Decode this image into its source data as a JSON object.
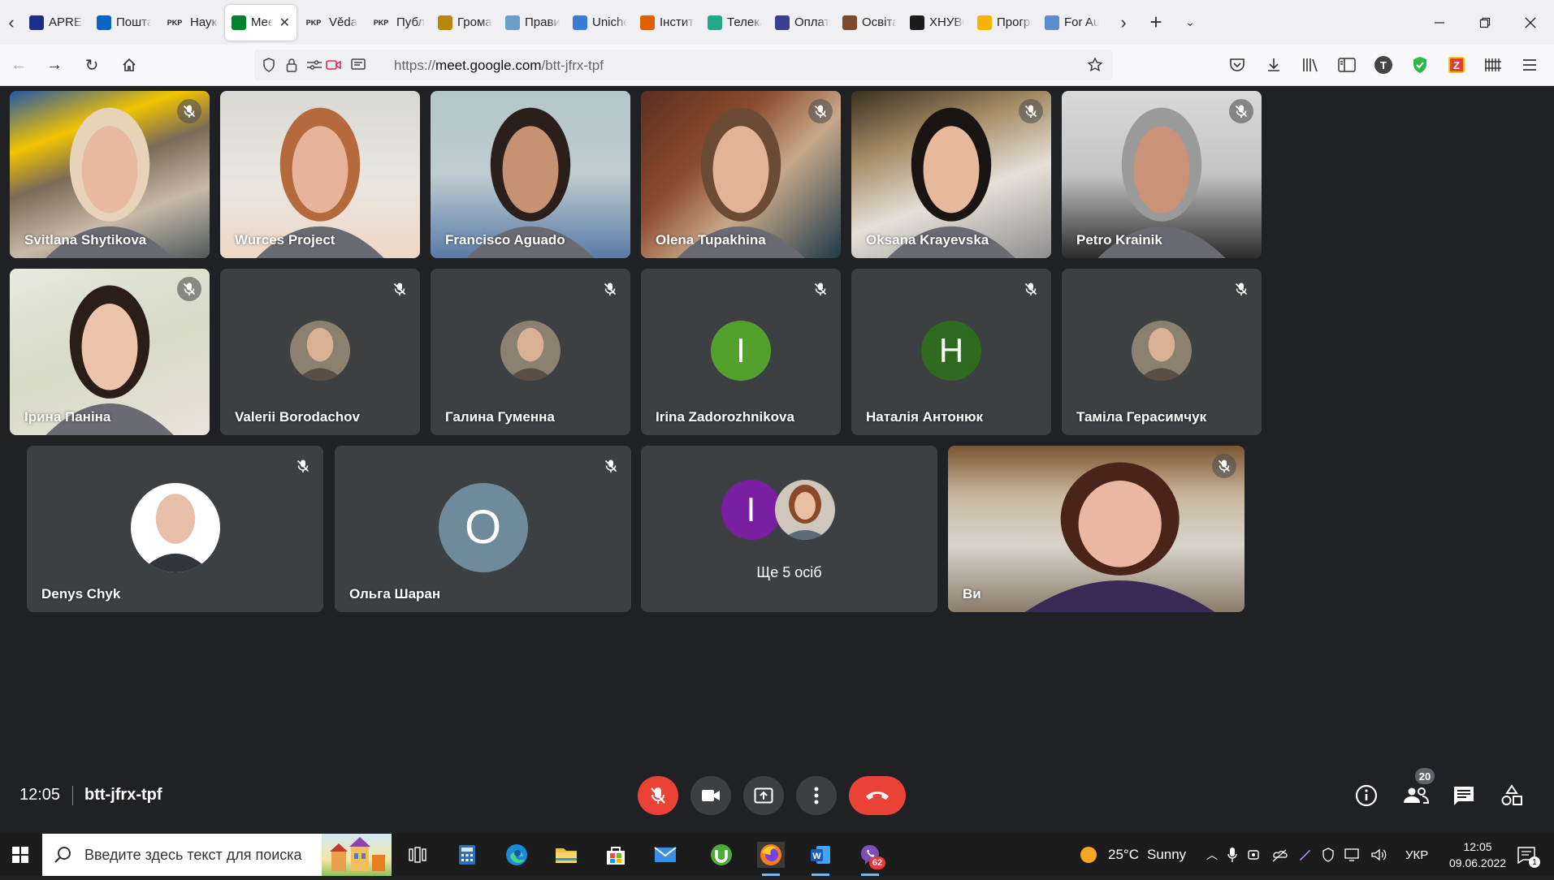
{
  "browser": {
    "tabs": [
      {
        "label": "APREI",
        "favicon_color": "#1b2f8a"
      },
      {
        "label": "Пошта",
        "favicon_color": "#0a64c8"
      },
      {
        "label": "Наукова",
        "favicon_color": "#333333",
        "favicon_text": "PKP"
      },
      {
        "label": "Meet - відео",
        "favicon_color": "#00832d",
        "active": true
      },
      {
        "label": "Věda a",
        "favicon_color": "#333333",
        "favicon_text": "PKP"
      },
      {
        "label": "Публікації",
        "favicon_color": "#333333",
        "favicon_text": "PKP"
      },
      {
        "label": "Громадськ",
        "favicon_color": "#b8860b"
      },
      {
        "label": "Правила",
        "favicon_color": "#6aa0c8"
      },
      {
        "label": "Unicheck",
        "favicon_color": "#3a7bd5"
      },
      {
        "label": "Інститут",
        "favicon_color": "#e06000"
      },
      {
        "label": "Телеканал",
        "favicon_color": "#22aa88"
      },
      {
        "label": "Оплата",
        "favicon_color": "#3b3f8f"
      },
      {
        "label": "Освіта",
        "favicon_color": "#7a4a2a"
      },
      {
        "label": "ХНУВС || Н",
        "favicon_color": "#1c1c1c"
      },
      {
        "label": "Програма",
        "favicon_color": "#f4b400"
      },
      {
        "label": "For Au",
        "favicon_color": "#5b8cd0"
      }
    ],
    "url_scheme": "https://",
    "url_domain": "meet.google.com",
    "url_path": "/btt-jfrx-tpf"
  },
  "meet": {
    "participants": [
      {
        "name": "Svitlana Shytikova",
        "type": "video",
        "muted": true
      },
      {
        "name": "Wurces Project",
        "type": "video",
        "muted": false
      },
      {
        "name": "Francisco Aguado",
        "type": "video",
        "muted": false
      },
      {
        "name": "Olena Tupakhina",
        "type": "video",
        "muted": true
      },
      {
        "name": "Oksana Krayevska",
        "type": "video",
        "muted": true
      },
      {
        "name": "Petro Krainik",
        "type": "video",
        "muted": true
      },
      {
        "name": "Ірина Паніна",
        "type": "video",
        "muted": true
      },
      {
        "name": "Valerii Borodachov",
        "type": "photo",
        "muted": true
      },
      {
        "name": "Галина Гуменна",
        "type": "photo",
        "muted": true
      },
      {
        "name": "Irina Zadorozhnikova",
        "type": "letter",
        "letter": "I",
        "color": "#54a02f",
        "muted": true
      },
      {
        "name": "Наталія Антонюк",
        "type": "letter",
        "letter": "Н",
        "color": "#2e6b1e",
        "muted": true
      },
      {
        "name": "Таміла Герасимчук",
        "type": "photo",
        "muted": true
      },
      {
        "name": "Denys Chyk",
        "type": "photo",
        "muted": true
      },
      {
        "name": "Ольга Шаран",
        "type": "letter",
        "letter": "О",
        "color": "#6f8a9a",
        "muted": true
      },
      {
        "name": "",
        "type": "group",
        "letter": "I",
        "color": "#7b1fa2",
        "more_label": "Ще 5 осіб"
      },
      {
        "name": "Ви",
        "type": "video",
        "muted": true
      }
    ],
    "time": "12:05",
    "meeting_code": "btt-jfrx-tpf",
    "people_count": "20",
    "colors": {
      "end_call": "#ea4335",
      "mic_off": "#ea4335",
      "control_bg": "#3c4043"
    }
  },
  "taskbar": {
    "search_placeholder": "Введите здесь текст для поиска",
    "weather_temp": "25°C",
    "weather_desc": "Sunny",
    "language": "УКР",
    "clock_time": "12:05",
    "clock_date": "09.06.2022",
    "viber_badge": "62",
    "notification_count": "1"
  }
}
